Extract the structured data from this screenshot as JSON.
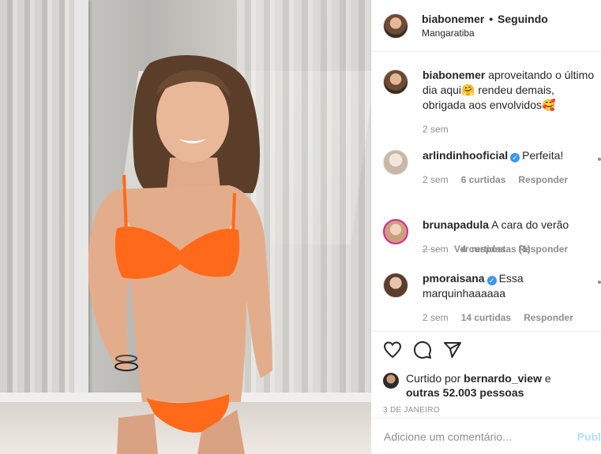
{
  "post": {
    "username": "biabonemer",
    "separator": "•",
    "follow_status": "Seguindo",
    "location": "Mangaratiba"
  },
  "caption": {
    "username": "biabonemer",
    "text": "aproveitando o último dia aqui🤗 rendeu demais, obrigada aos envolvidos🥰",
    "time": "2 sem"
  },
  "comments": [
    {
      "username": "arlindinhooficial",
      "verified": true,
      "text": "Perfeita!",
      "time": "2 sem",
      "likes": "6 curtidas",
      "reply": "Responder",
      "view_replies": "Ver respostas (1)"
    },
    {
      "username": "brunapadula",
      "verified": false,
      "text": "A cara do verão",
      "time": "2 sem",
      "likes": "4 curtidas",
      "reply": "Responder"
    },
    {
      "username": "pmoraisana",
      "verified": true,
      "text": "Essa marquinhaaaaaa",
      "time": "2 sem",
      "likes": "14 curtidas",
      "reply": "Responder"
    }
  ],
  "actions": {
    "icons": [
      "heart-icon",
      "comment-icon",
      "share-icon"
    ]
  },
  "likes": {
    "prefix": "Curtido por",
    "user": "bernardo_view",
    "conj": "e",
    "others": "outras 52.003 pessoas"
  },
  "date": "3 DE JANEIRO",
  "add_comment": {
    "placeholder": "Adicione um comentário...",
    "publish_label": "Publ"
  },
  "colors": {
    "accent": "#3897f0",
    "publish": "#b2dffc",
    "muted": "#8e8e8e",
    "bikini": "#ff6a1a"
  }
}
